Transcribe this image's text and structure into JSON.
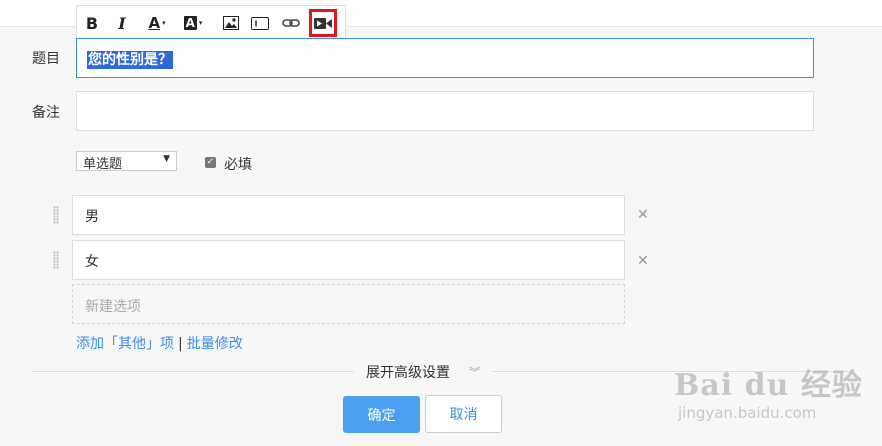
{
  "toolbar": {
    "bold_label": "B",
    "italic_label": "I",
    "font_color_label": "A",
    "bg_color_label": "A",
    "icons": [
      "bold-icon",
      "italic-icon",
      "font-color-icon",
      "background-color-icon",
      "image-icon",
      "textbox-icon",
      "link-icon",
      "video-icon"
    ],
    "highlight_color": "#e3141b"
  },
  "form": {
    "title_label": "题目",
    "title_value": "您的性别是？",
    "note_label": "备注",
    "note_value": "",
    "type_select": "单选题",
    "required_label": "必填",
    "required_checked": true,
    "options": [
      {
        "label": "男"
      },
      {
        "label": "女"
      }
    ],
    "new_option_placeholder": "新建选项",
    "add_other_link": "添加「其他」项",
    "link_separator": "|",
    "batch_edit_link": "批量修改",
    "advanced_label": "展开高级设置",
    "ok_button": "确定",
    "cancel_button": "取消"
  },
  "colors": {
    "accent": "#3a8ee6",
    "primary_button": "#4a9ff0",
    "selection": "#2d6ad8"
  },
  "watermark": {
    "logo": "Bai du 经验",
    "url": "jingyan.baidu.com"
  }
}
